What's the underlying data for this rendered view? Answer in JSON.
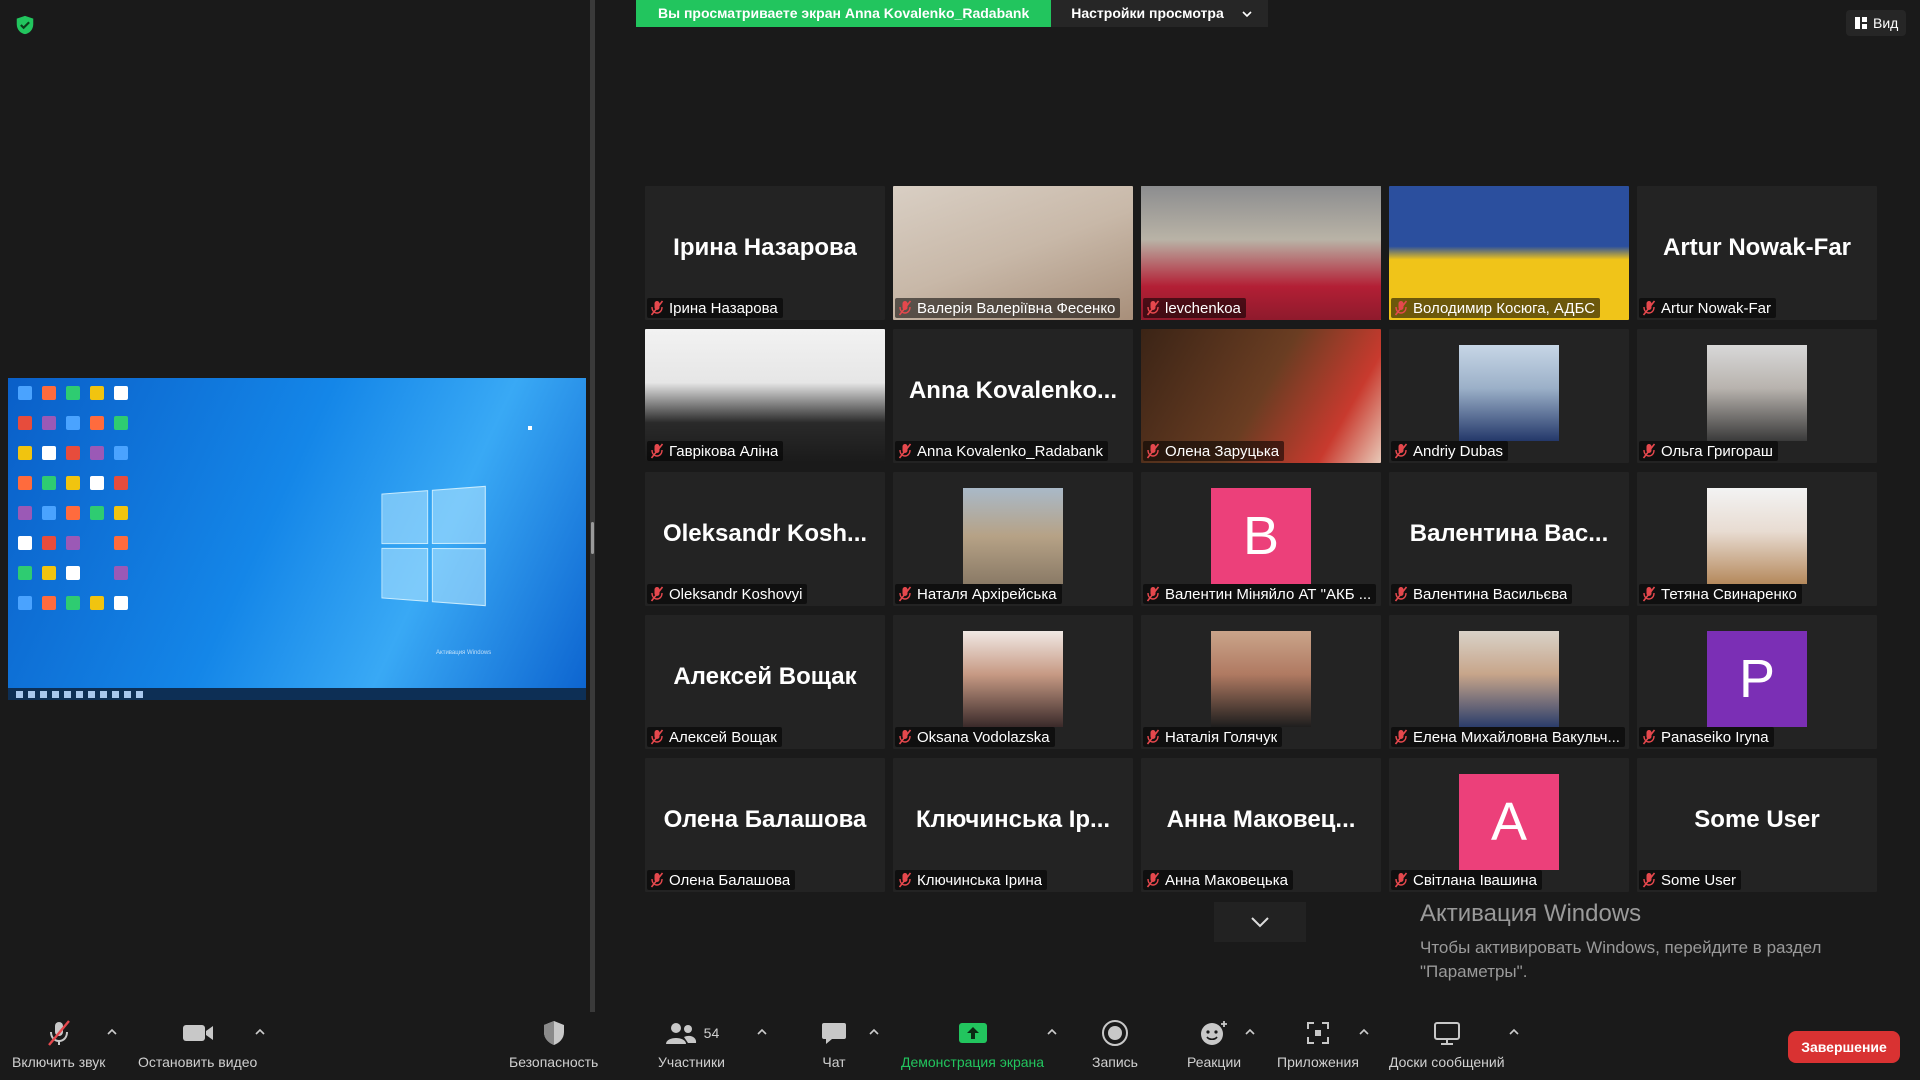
{
  "banner": {
    "viewing_text": "Вы просматриваете экран Anna Kovalenko_Radabank",
    "view_settings": "Настройки просмотра"
  },
  "view_button": "Вид",
  "colors": {
    "green": "#22c55e",
    "active_border": "#d6e64a",
    "end_red": "#d93232",
    "mic_off": "#e5484d"
  },
  "tiles": [
    {
      "name": "Ірина Назарова",
      "display": "Ірина Назарова",
      "type": "text"
    },
    {
      "name": "Валерія Валеріївна Фесенко",
      "type": "video"
    },
    {
      "name": "levchenkoa",
      "type": "video",
      "active": true
    },
    {
      "name": "Володимир Косюга, АДБС",
      "type": "video"
    },
    {
      "name": "Artur Nowak-Far",
      "display": "Artur Nowak-Far",
      "type": "text"
    },
    {
      "name": "Гаврікова Аліна",
      "type": "video"
    },
    {
      "name": "Anna Kovalenko_Radabank",
      "display": "Anna Kovalenko...",
      "type": "text"
    },
    {
      "name": "Олена Заруцька",
      "type": "video"
    },
    {
      "name": "Andriy Dubas",
      "type": "photo"
    },
    {
      "name": "Ольга Григораш",
      "type": "photo"
    },
    {
      "name": "Oleksandr Koshovyi",
      "display": "Oleksandr Kosh...",
      "type": "text"
    },
    {
      "name": "Наталя Архірейська",
      "type": "photo"
    },
    {
      "name": "Валентин Міняйло АТ \"АКБ ...",
      "type": "letter",
      "letter": "B",
      "color": "#ec407a"
    },
    {
      "name": "Валентина Васильєва",
      "display": "Валентина Вас...",
      "type": "text"
    },
    {
      "name": "Тетяна Свинаренко",
      "type": "photo"
    },
    {
      "name": "Алексей Вощак",
      "display": "Алексей Вощак",
      "type": "text"
    },
    {
      "name": "Oksana Vodolazska",
      "type": "photo"
    },
    {
      "name": "Наталія Голячук",
      "type": "photo"
    },
    {
      "name": "Елена Михайловна Вакульч...",
      "type": "photo"
    },
    {
      "name": "Panaseiko Iryna",
      "type": "letter",
      "letter": "P",
      "color": "#7b2fb5"
    },
    {
      "name": "Олена Балашова",
      "display": "Олена Балашова",
      "type": "text"
    },
    {
      "name": "Ключинська Ірина",
      "display": "Ключинська Ір...",
      "type": "text"
    },
    {
      "name": "Анна Маковецька",
      "display": "Анна Маковец...",
      "type": "text"
    },
    {
      "name": "Світлана Івашина",
      "type": "letter",
      "letter": "A",
      "color": "#ec407a"
    },
    {
      "name": "Some User",
      "display": "Some User",
      "type": "text"
    }
  ],
  "activation": {
    "title": "Активация Windows",
    "text": "Чтобы активировать Windows, перейдите в раздел \"Параметры\"."
  },
  "thumbnail": {
    "activation_title": "Активация Windows"
  },
  "toolbar": {
    "unmute": "Включить звук",
    "stop_video": "Остановить видео",
    "security": "Безопасность",
    "participants": "Участники",
    "participants_count": "54",
    "chat": "Чат",
    "share_screen": "Демонстрация экрана",
    "record": "Запись",
    "reactions": "Реакции",
    "apps": "Приложения",
    "whiteboards": "Доски сообщений",
    "end": "Завершение"
  }
}
